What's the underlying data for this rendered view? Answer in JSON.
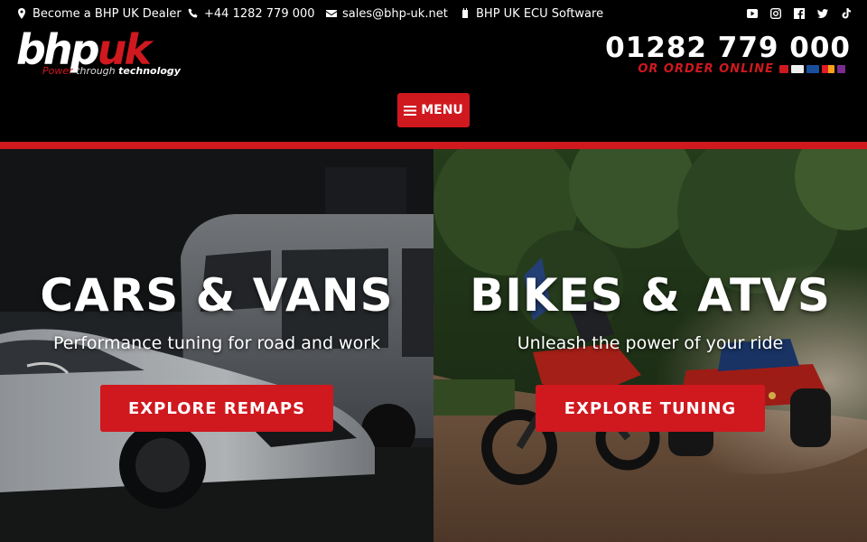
{
  "topbar": {
    "dealer": "Become a BHP UK Dealer",
    "phone": "+44 1282 779 000",
    "email": "sales@bhp-uk.net",
    "software": "BHP UK ECU Software",
    "social_icons": [
      "youtube-icon",
      "instagram-icon",
      "facebook-icon",
      "twitter-icon",
      "tiktok-icon"
    ]
  },
  "header": {
    "logo": {
      "word_1": "bhp",
      "word_2": "uk",
      "tagline_1": "Power",
      "tagline_2": "through",
      "tagline_3": "technology"
    },
    "phone": "01282 779 000",
    "order_online": "OR ORDER ONLINE",
    "menu_label": "MENU"
  },
  "hero": {
    "left": {
      "title": "CARS & VANS",
      "subtitle": "Performance tuning for road and work",
      "button": "EXPLORE REMAPS"
    },
    "right": {
      "title": "BIKES & ATVS",
      "subtitle": "Unleash the power of your ride",
      "button": "EXPLORE TUNING"
    }
  },
  "colors": {
    "accent_red": "#d0181f",
    "background": "#000000"
  }
}
